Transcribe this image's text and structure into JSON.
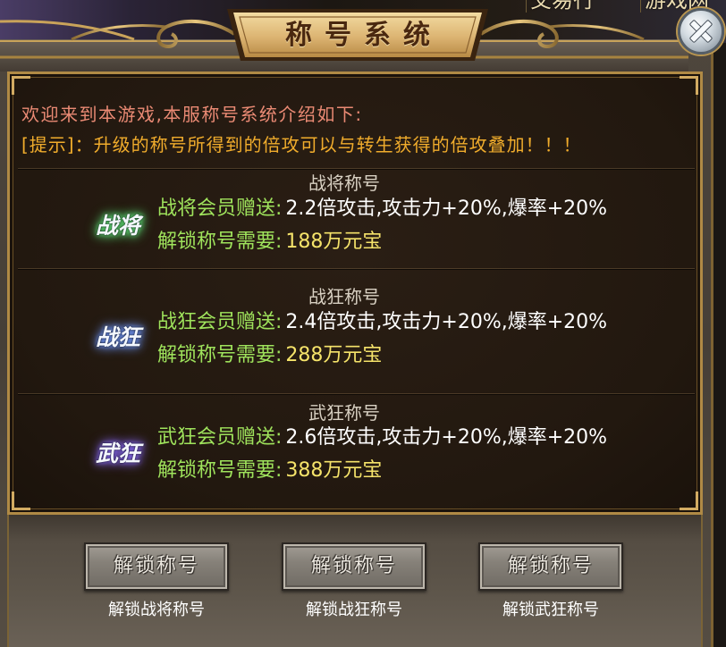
{
  "background_tabs": [
    "交易行",
    "游戏网"
  ],
  "window": {
    "title": "称号系统",
    "close_icon": "close-icon"
  },
  "intro": {
    "welcome": "欢迎来到本游戏,本服称号系统介绍如下:",
    "tip": "[提示]：升级的称号所得到的倍攻可以与转生获得的倍攻叠加！！！"
  },
  "titles": [
    {
      "name": "战将称号",
      "badge": "战将",
      "badge_glow": "#5fe47a",
      "gift_label": "战将会员赠送:",
      "gift_value": "2.2倍攻击,攻击力+20%,爆率+20%",
      "unlock_label": "解锁称号需要:",
      "unlock_cost": "188万元宝"
    },
    {
      "name": "战狂称号",
      "badge": "战狂",
      "badge_glow": "#6f98ff",
      "gift_label": "战狂会员赠送:",
      "gift_value": "2.4倍攻击,攻击力+20%,爆率+20%",
      "unlock_label": "解锁称号需要:",
      "unlock_cost": "288万元宝"
    },
    {
      "name": "武狂称号",
      "badge": "武狂",
      "badge_glow": "#8a6cff",
      "gift_label": "武狂会员赠送:",
      "gift_value": "2.6倍攻击,攻击力+20%,爆率+20%",
      "unlock_label": "解锁称号需要:",
      "unlock_cost": "388万元宝"
    }
  ],
  "actions": [
    {
      "button_label": "解锁称号",
      "caption": "解锁战将称号"
    },
    {
      "button_label": "解锁称号",
      "caption": "解锁战狂称号"
    },
    {
      "button_label": "解锁称号",
      "caption": "解锁武狂称号"
    }
  ],
  "colors": {
    "welcome_text": "#ea8a74",
    "tip_text": "#f0ac2c",
    "section_title": "#d8d0c2",
    "label_green": "#9fe35c",
    "value_white": "#ffffff",
    "cost_yellow": "#f5e36a",
    "gold_trim": "#b08a45",
    "panel_bg": "#22180f",
    "title_text": "#4a2810",
    "button_text": "#ece8e0",
    "caption_text": "#ffffff"
  }
}
